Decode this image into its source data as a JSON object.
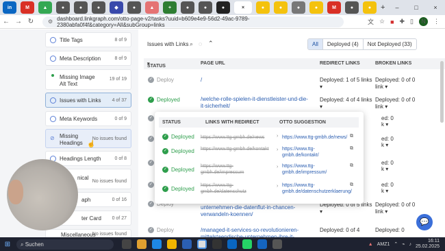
{
  "browser": {
    "url": "dashboard.linkgraph.com/otto-page-v2/tasks?uuid=b609e4e9-56d2-49ac-9789-2380abfa0f4f&category=All&subGroup=links",
    "tab_close": "×",
    "new_tab": "+",
    "avatar_letter": "N",
    "window_controls": [
      "–",
      "□",
      "×"
    ]
  },
  "sidebar": {
    "items": [
      {
        "label": "Title Tags",
        "count": "8 of 9"
      },
      {
        "label": "Meta Description",
        "count": "8 of 9"
      },
      {
        "label": "Missing Image Alt Text",
        "count": "19 of 19"
      },
      {
        "label": "Issues with Links",
        "count": "4 of 37"
      },
      {
        "label": "Meta Keywords",
        "count": "0 of 9"
      },
      {
        "label": "Missing Headings",
        "count": "No issues found"
      },
      {
        "label": "Headings Length",
        "count": "0 of 8"
      },
      {
        "label": "nical",
        "count": "No issues found"
      },
      {
        "label": "aph",
        "count": "0 of 16"
      },
      {
        "label": "ter Card",
        "count": "0 of 27"
      },
      {
        "label": "Miscellaneous",
        "count": "No issues found"
      }
    ]
  },
  "main": {
    "title": "Issues with Links",
    "filters": [
      "All",
      "Deployed (4)",
      "Not Deployed (33)"
    ],
    "columns": [
      "STATUS",
      "PAGE URL",
      "REDIRECT LINKS",
      "BROKEN LINKS"
    ],
    "rows": [
      {
        "status": "Deploy",
        "url": "/",
        "redirect": "Deployed: 1 of 5 links",
        "broken": "Deployed: 0 of 0 link"
      },
      {
        "status": "Deployed",
        "url": "/welche-rolle-spielen-it-dienstleister-und-die-it-sicherheit/",
        "redirect": "Deployed: 4 of 4 links",
        "broken": "Deployed: 0 of 0 link"
      },
      {
        "status": "Deploy",
        "url": "unternehmen-die-datenflut-in-chancen-verwandeln-koennen/",
        "redirect": "Deployed: 0 of 5 links",
        "broken": "Deployed: 0 of 0 link"
      },
      {
        "status": "Deploy",
        "url": "/managed-it-services-so-revolutionieren-mittelstaendische-unternehmen-ihre-it-",
        "redirect": "Deployed: 0 of 4",
        "broken": "Deployed: 0"
      }
    ]
  },
  "popup": {
    "columns": [
      "STATUS",
      "LINKS WITH REDIRECT",
      "OTTO SUGGESTION"
    ],
    "rows": [
      {
        "status": "Deployed",
        "old": "https://www.ttg-gmbh.de/news",
        "new": "https://www.ttg-gmbh.de/news/"
      },
      {
        "status": "Deployed",
        "old": "https://www.ttg-gmbh.de/kontakt",
        "new": "https://www.ttg-gmbh.de/kontakt/"
      },
      {
        "status": "Deployed",
        "old": "https://www.ttg-gmbh.de/impressum",
        "new": "https://www.ttg-gmbh.de/impressum/"
      },
      {
        "status": "Deployed",
        "old": "https://www.ttg-gmbh.de/datenschutz",
        "new": "https://www.ttg-gmbh.de/datenschutzerklaerung/"
      }
    ]
  },
  "taskbar": {
    "search": "Suchen",
    "weather": "AMZ1",
    "time": "16:11",
    "date": "25.02.2025"
  },
  "colors": {
    "accent": "#2a5db0",
    "deployed": "#2e9e4c",
    "chat": "#3b6fd9"
  }
}
